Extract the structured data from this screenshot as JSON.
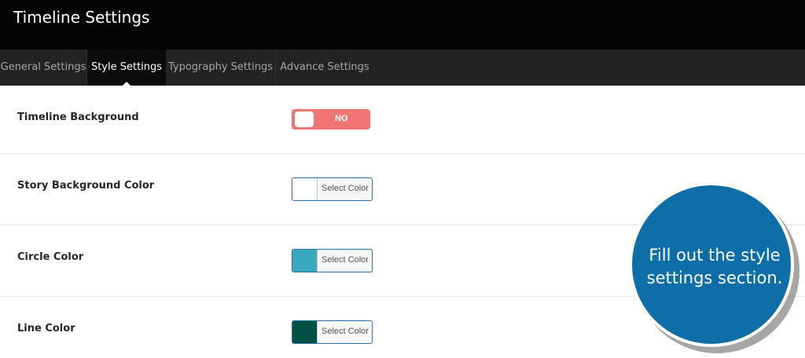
{
  "header": {
    "title": "Timeline Settings"
  },
  "tabs": [
    {
      "label": "General Settings",
      "active": false
    },
    {
      "label": "Style Settings",
      "active": true
    },
    {
      "label": "Typography Settings",
      "active": false
    },
    {
      "label": "Advance Settings",
      "active": false
    }
  ],
  "settings": {
    "timeline_background": {
      "label": "Timeline Background",
      "toggle_text": "NO",
      "toggle_color": "#f27575"
    },
    "story_background_color": {
      "label": "Story Background Color",
      "button_label": "Select Color",
      "swatch": "#ffffff"
    },
    "circle_color": {
      "label": "Circle Color",
      "button_label": "Select Color",
      "swatch": "#3aa9bf"
    },
    "line_color": {
      "label": "Line Color",
      "button_label": "Select Color",
      "swatch": "#024f46"
    }
  },
  "callout": {
    "line1": "Fill out the style",
    "line2": "settings section."
  },
  "colors": {
    "header_bg": "#050505",
    "tabbar_bg": "#232323",
    "callout_bg": "#0e6fa8"
  }
}
